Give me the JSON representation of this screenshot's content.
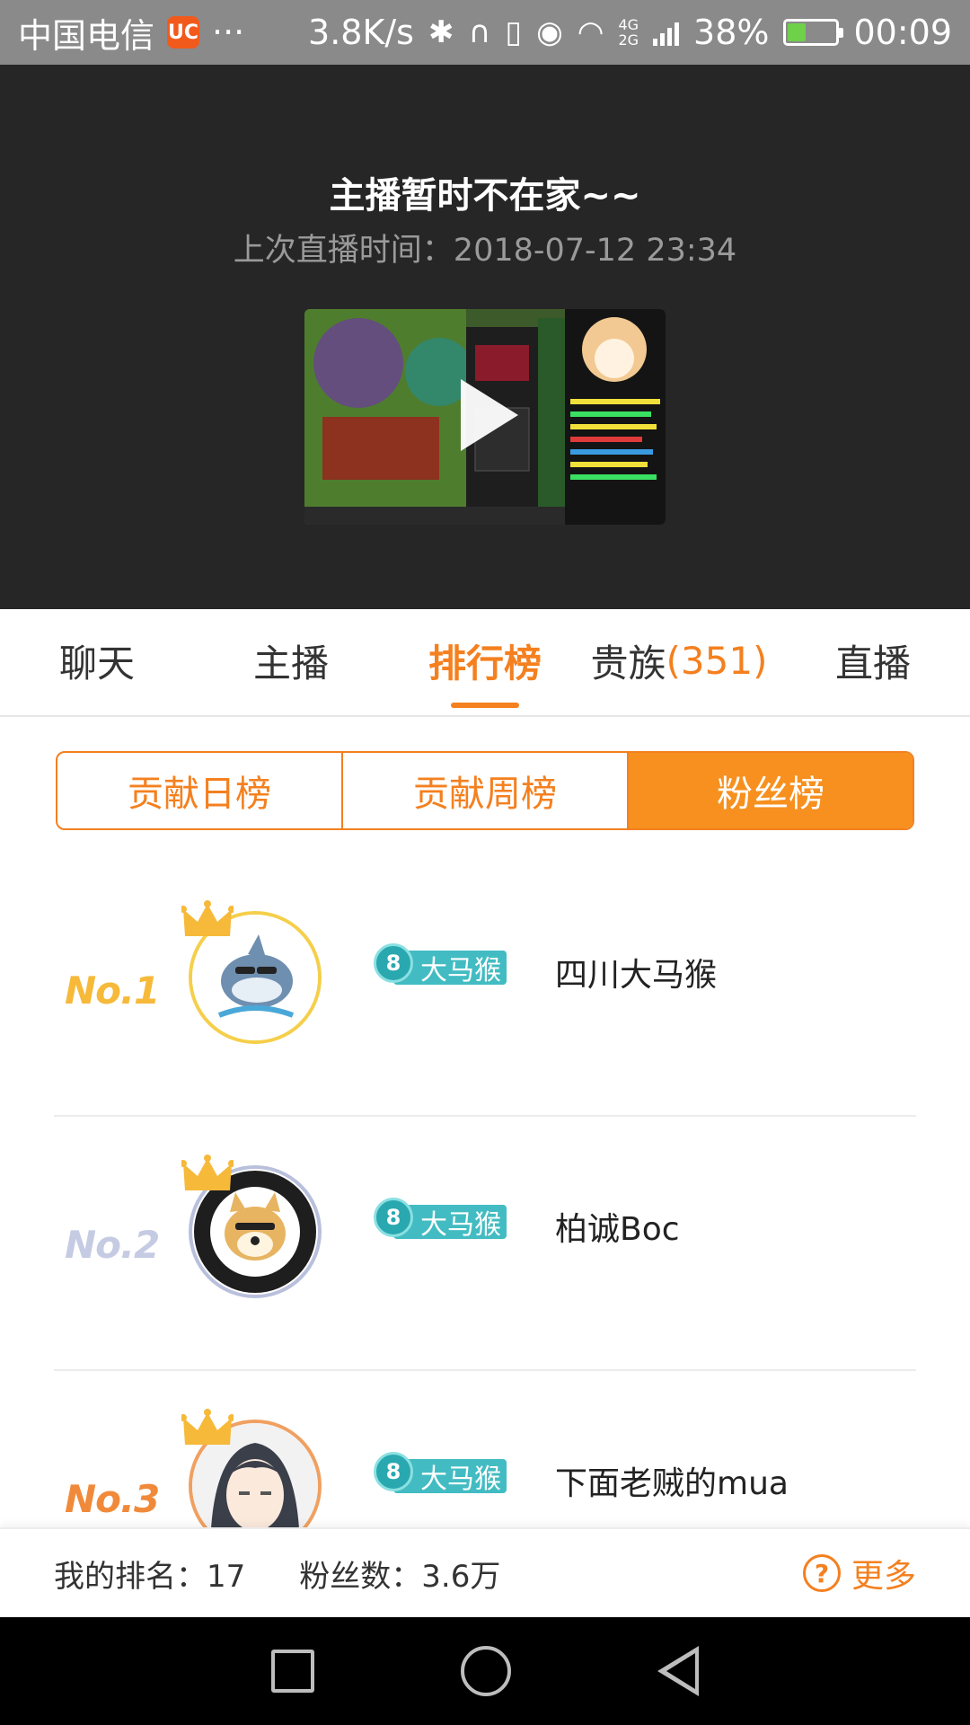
{
  "status_bar": {
    "carrier": "中国电信",
    "uc_icon": "uc-browser-icon",
    "more": "···",
    "net_speed": "3.8K/s",
    "net_tags": [
      "4G",
      "2G"
    ],
    "battery_percent": "38%",
    "battery_level": 0.38,
    "time": "00:09"
  },
  "player": {
    "offline_title": "主播暂时不在家~~",
    "last_live_label": "上次直播时间：2018-07-12  23:34"
  },
  "tabs": [
    {
      "label": "聊天",
      "count": ""
    },
    {
      "label": "主播",
      "count": ""
    },
    {
      "label": "排行榜",
      "count": ""
    },
    {
      "label": "贵族",
      "count": "(351)"
    },
    {
      "label": "直播",
      "count": ""
    }
  ],
  "segment": [
    "贡献日榜",
    "贡献周榜",
    "粉丝榜"
  ],
  "ranking": [
    {
      "rank": "No.1",
      "level": "8",
      "badge": "大马猴",
      "name": "四川大马猴",
      "rank_color": "#f6b93a"
    },
    {
      "rank": "No.2",
      "level": "8",
      "badge": "大马猴",
      "name": "柏诚Boc",
      "rank_color": "#c5cbe3"
    },
    {
      "rank": "No.3",
      "level": "8",
      "badge": "大马猴",
      "name": "下面老贼的mua",
      "rank_color": "#f08a3a"
    }
  ],
  "footer": {
    "my_rank": "我的排名：17",
    "fans": "粉丝数：3.6万",
    "more": "更多"
  },
  "colors": {
    "accent": "#f4801f",
    "badge": "#42bcc2"
  }
}
